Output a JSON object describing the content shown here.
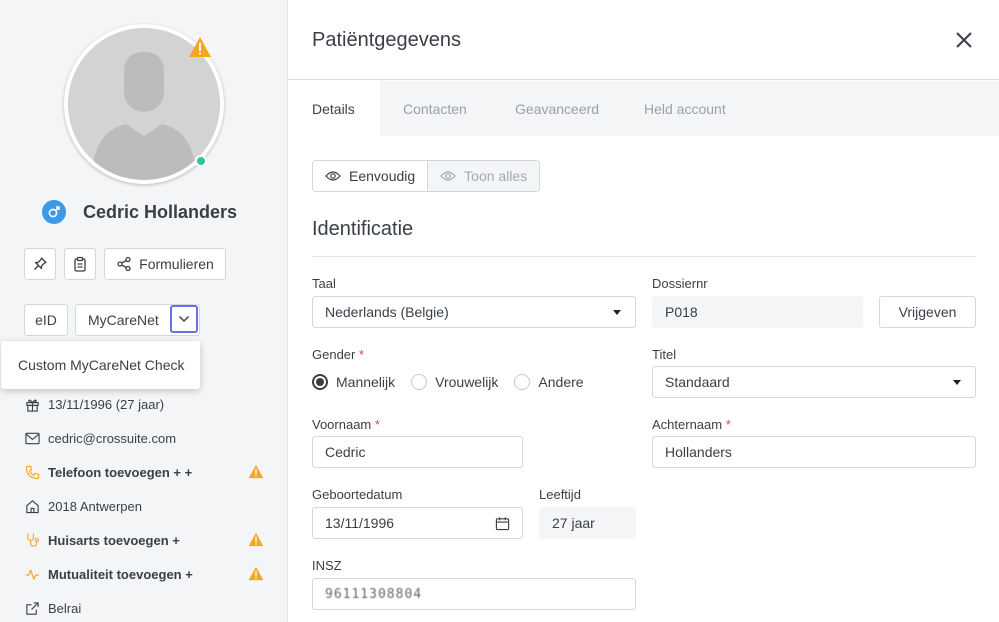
{
  "sidebar": {
    "patient_name": "Cedric Hollanders",
    "buttons": {
      "forms_label": "Formulieren",
      "eid_label": "eID",
      "mycarenet_label": "MyCareNet"
    },
    "popup_item": "Custom MyCareNet Check",
    "info": {
      "birth": "13/11/1996 (27 jaar)",
      "email": "cedric@crossuite.com",
      "phone": "Telefoon toevoegen + +",
      "address": "2018 Antwerpen",
      "gp": "Huisarts toevoegen +",
      "mutuality": "Mutualiteit toevoegen +",
      "belrai": "Belrai"
    }
  },
  "main": {
    "title": "Patiëntgegevens",
    "tabs": [
      {
        "label": "Details",
        "active": true
      },
      {
        "label": "Contacten",
        "active": false
      },
      {
        "label": "Geavanceerd",
        "active": false
      },
      {
        "label": "Held account",
        "active": false
      }
    ],
    "view_toggle": {
      "simple": "Eenvoudig",
      "all": "Toon alles"
    },
    "section_title": "Identificatie",
    "form": {
      "language": {
        "label": "Taal",
        "value": "Nederlands (Belgie)"
      },
      "file_nr": {
        "label": "Dossiernr",
        "value": "P018",
        "button": "Vrijgeven"
      },
      "gender": {
        "label": "Gender",
        "required": "*",
        "options": [
          "Mannelijk",
          "Vrouwelijk",
          "Andere"
        ],
        "selected": "Mannelijk"
      },
      "title": {
        "label": "Titel",
        "value": "Standaard"
      },
      "firstname": {
        "label": "Voornaam",
        "required": "*",
        "value": "Cedric"
      },
      "lastname": {
        "label": "Achternaam",
        "required": "*",
        "value": "Hollanders"
      },
      "birthdate": {
        "label": "Geboortedatum",
        "value": "13/11/1996"
      },
      "age": {
        "label": "Leeftijd",
        "value": "27 jaar"
      },
      "insz": {
        "label": "INSZ",
        "value": "96111308804"
      }
    }
  },
  "colors": {
    "accent_blue": "#3b99e8",
    "warning": "#f5a623",
    "online": "#2bc7a0",
    "focus": "#6e6ee0",
    "required": "#e0465b"
  }
}
